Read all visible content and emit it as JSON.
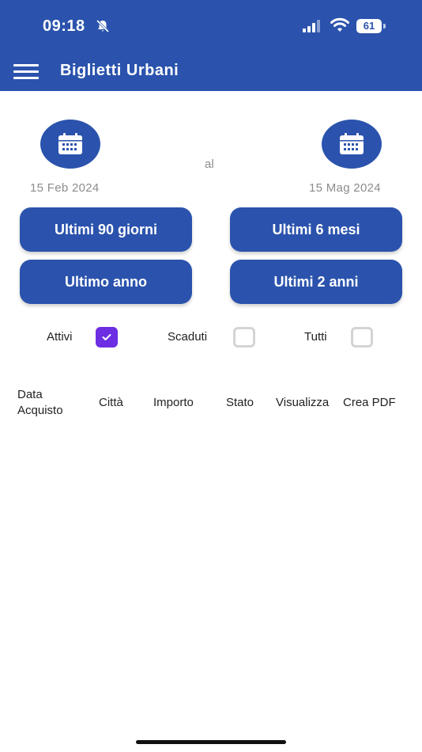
{
  "status_bar": {
    "time": "09:18",
    "battery": "61"
  },
  "header": {
    "title": "Biglietti Urbani"
  },
  "date_range": {
    "start_date": "15 Feb 2024",
    "separator": "al",
    "end_date": "15 Mag 2024"
  },
  "quick_ranges": [
    "Ultimi 90 giorni",
    "Ultimi 6 mesi",
    "Ultimo anno",
    "Ultimi 2 anni"
  ],
  "filters": [
    {
      "label": "Attivi",
      "checked": true
    },
    {
      "label": "Scaduti",
      "checked": false
    },
    {
      "label": "Tutti",
      "checked": false
    }
  ],
  "table": {
    "columns": [
      "Data\nAcquisto",
      "Città",
      "Importo",
      "Stato",
      "Visualizza",
      "Crea PDF"
    ]
  },
  "colors": {
    "primary": "#2b53ad",
    "checkbox_checked": "#6c2de3"
  }
}
